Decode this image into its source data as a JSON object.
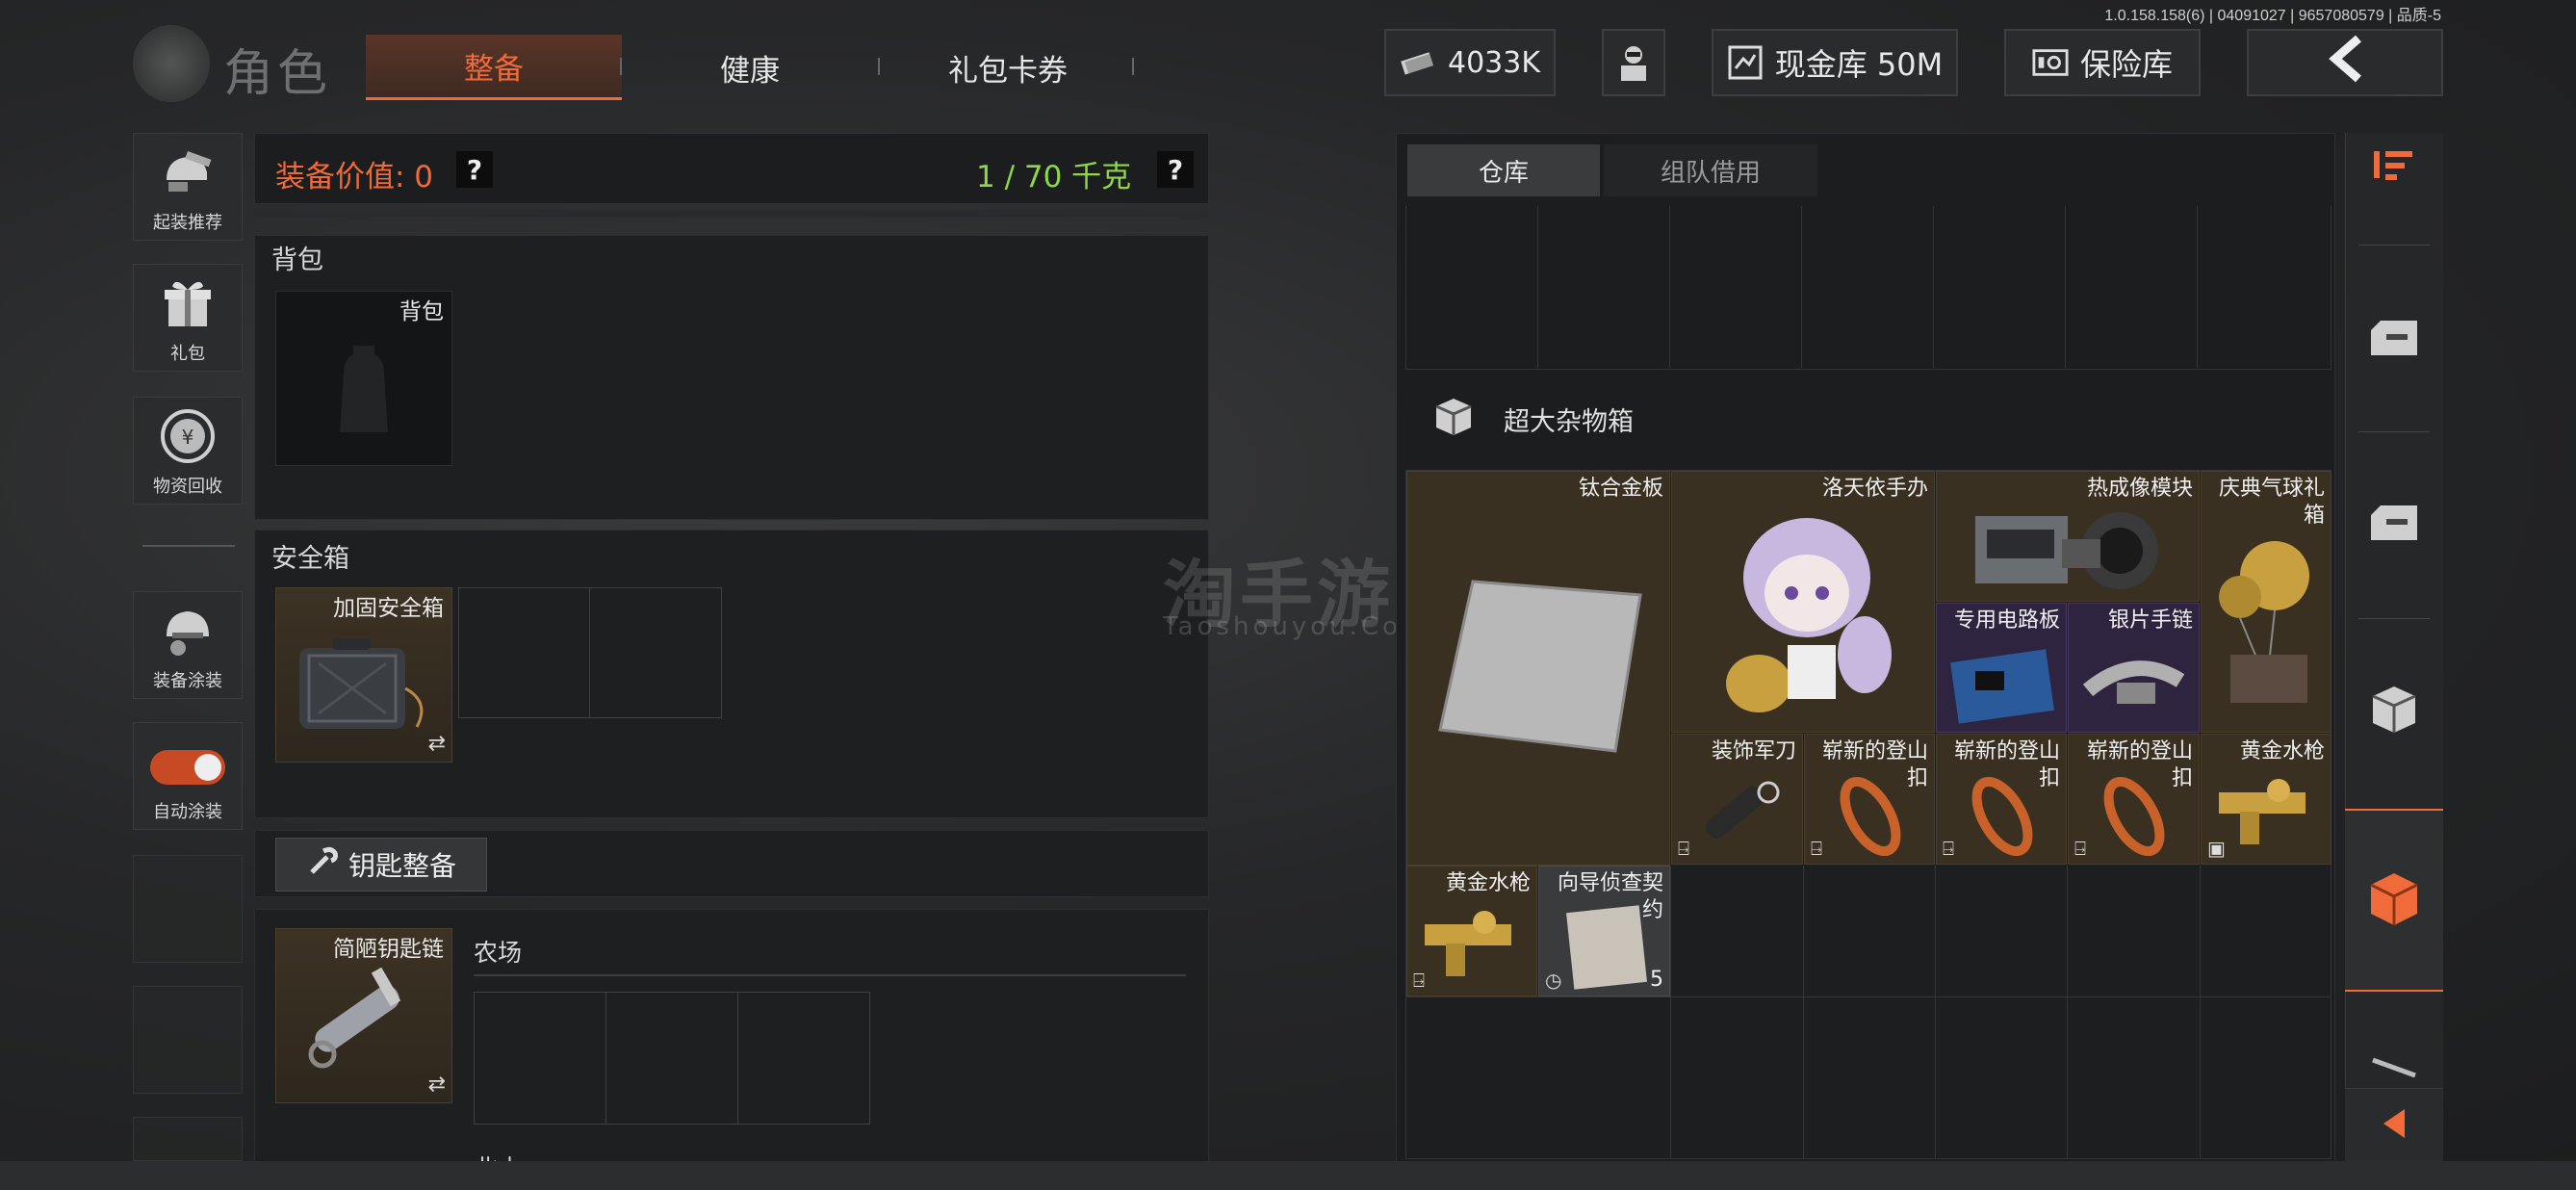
{
  "version": "1.0.158.158(6) | 04091027 | 9657080579 | 品质-5",
  "header": {
    "title": "角色",
    "tabs": [
      {
        "label": "整备",
        "active": true
      },
      {
        "label": "健康",
        "active": false
      },
      {
        "label": "礼包卡券",
        "active": false
      }
    ],
    "currency": "4033K",
    "cash_vault": "现金库 50M",
    "safe": "保险库"
  },
  "sidebar": {
    "items": [
      {
        "label": "起装推荐",
        "icon": "helmet-gun-icon"
      },
      {
        "label": "礼包",
        "icon": "gift-icon"
      },
      {
        "label": "物资回收",
        "icon": "recycle-icon"
      },
      {
        "label": "装备涂装",
        "icon": "paint-helmet-icon"
      },
      {
        "label": "自动涂装",
        "icon": "toggle-switch"
      }
    ]
  },
  "equipment": {
    "value_label": "装备价值: 0",
    "help": "?",
    "weight": "1 / 70 千克",
    "backpack_section": "背包",
    "backpack_slot": "背包",
    "safebox_section": "安全箱",
    "safebox_slot": "加固安全箱",
    "key_button": "钥匙整备",
    "keychain_slot": "简陋钥匙链",
    "farm_label": "农场",
    "next_label": "北山"
  },
  "inventory": {
    "tabs": [
      {
        "label": "仓库",
        "active": true
      },
      {
        "label": "组队借用",
        "active": false
      }
    ],
    "category": "超大杂物箱",
    "items": [
      {
        "name": "钛合金板",
        "color": "gold"
      },
      {
        "name": "洛天依手办",
        "color": "gold"
      },
      {
        "name": "热成像模块",
        "color": "gold"
      },
      {
        "name": "庆典气球礼箱",
        "color": "gold"
      },
      {
        "name": "专用电路板",
        "color": "purple"
      },
      {
        "name": "银片手链",
        "color": "purple"
      },
      {
        "name": "装饰军刀",
        "color": "gold"
      },
      {
        "name": "崭新的登山扣",
        "color": "gold"
      },
      {
        "name": "崭新的登山扣",
        "color": "gold"
      },
      {
        "name": "崭新的登山扣",
        "color": "gold"
      },
      {
        "name": "黄金水枪",
        "color": "gold"
      },
      {
        "name": "黄金水枪",
        "color": "gold"
      },
      {
        "name": "向导侦查契约",
        "count": "5",
        "color": "gray"
      }
    ]
  },
  "watermark": {
    "main": "淘手游",
    "sub": "Taoshouyou.Com"
  },
  "colors": {
    "accent": "#f06a3a",
    "weight_green": "#8fd64a",
    "gold_item": "#3a3022",
    "purple_item": "#2e2440"
  }
}
